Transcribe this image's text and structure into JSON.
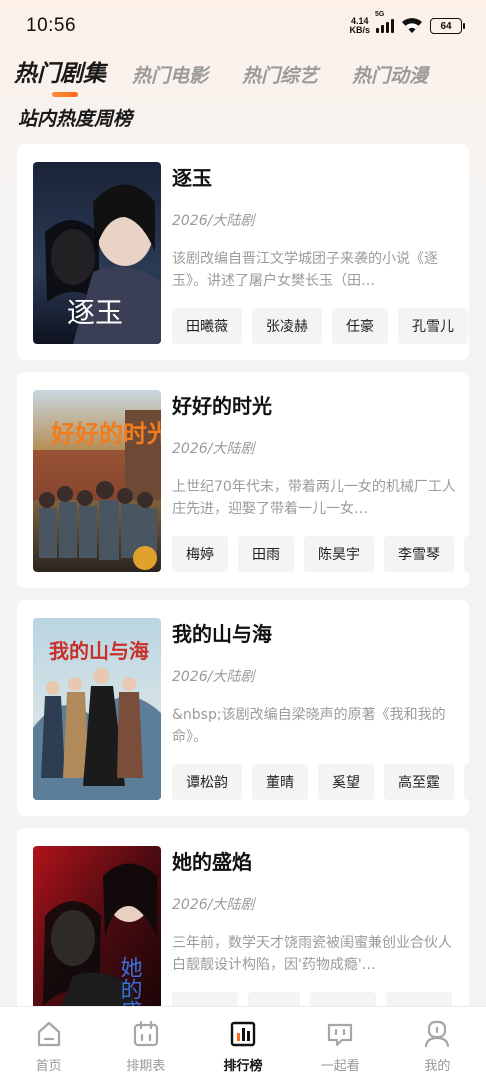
{
  "status": {
    "time": "10:56",
    "net_speed_value": "4.14",
    "net_speed_unit": "KB/s",
    "network": "5G",
    "battery": "64"
  },
  "top_tabs": [
    {
      "label": "热门剧集",
      "active": true
    },
    {
      "label": "热门电影",
      "active": false
    },
    {
      "label": "热门综艺",
      "active": false
    },
    {
      "label": "热门动漫",
      "active": false
    }
  ],
  "section_title": "站内热度周榜",
  "shows": [
    {
      "title": "逐玉",
      "meta": "2026/大陆剧",
      "desc": "该剧改编自晋江文学城团子来袭的小说《逐玉》。讲述了屠户女樊长玉（田…",
      "cast": [
        "田曦薇",
        "张凌赫",
        "任豪",
        "孔雪儿"
      ],
      "poster_text": "逐玉"
    },
    {
      "title": "好好的时光",
      "meta": "2026/大陆剧",
      "desc": "上世纪70年代末，带着两儿一女的机械厂工人庄先进，迎娶了带着一儿一女…",
      "cast": [
        "梅婷",
        "田雨",
        "陈昊宇",
        "李雪琴",
        ""
      ],
      "poster_text": "好好的时光"
    },
    {
      "title": "我的山与海",
      "meta": "2026/大陆剧",
      "desc": "&nbsp;该剧改编自梁晓声的原著《我和我的命》。",
      "cast": [
        "谭松韵",
        "董晴",
        "奚望",
        "高至霆",
        ""
      ],
      "poster_text": "我的山与海"
    },
    {
      "title": "她的盛焰",
      "meta": "2026/大陆剧",
      "desc": "三年前，数学天才饶雨瓷被闺蜜兼创业合伙人白靓靓设计构陷，因'药物成瘾'…",
      "cast": [
        "",
        "",
        "",
        ""
      ],
      "poster_text": "她的盛焰"
    }
  ],
  "bottom_nav": [
    {
      "label": "首页",
      "icon": "home-icon",
      "active": false
    },
    {
      "label": "排期表",
      "icon": "calendar-icon",
      "active": false
    },
    {
      "label": "排行榜",
      "icon": "ranking-icon",
      "active": true
    },
    {
      "label": "一起看",
      "icon": "watch-together-icon",
      "active": false
    },
    {
      "label": "我的",
      "icon": "profile-icon",
      "active": false
    }
  ],
  "colors": {
    "accent": "#ff6a1a",
    "text_secondary": "#9b9b9b",
    "chip_bg": "#f4f4f4"
  }
}
